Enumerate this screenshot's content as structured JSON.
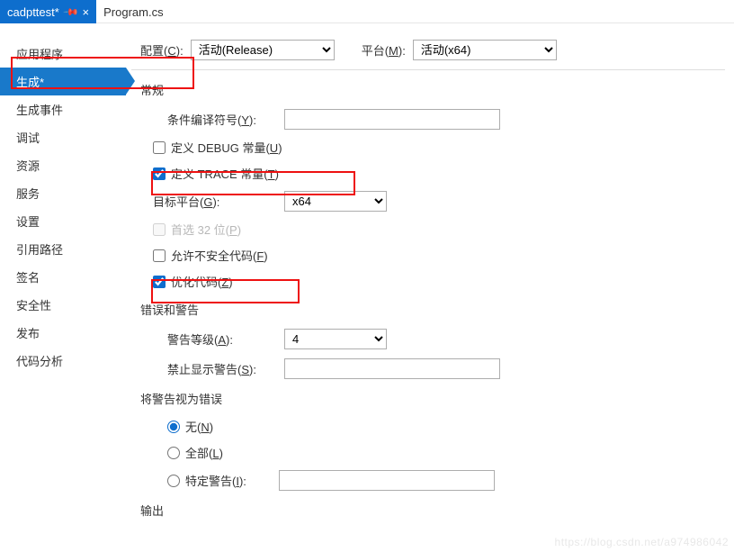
{
  "tabs": {
    "active": {
      "label": "cadpttest*",
      "pin": "⨯",
      "close": "×"
    },
    "inactive": {
      "label": "Program.cs"
    }
  },
  "sidebar": {
    "items": [
      "应用程序",
      "生成*",
      "生成事件",
      "调试",
      "资源",
      "服务",
      "设置",
      "引用路径",
      "签名",
      "安全性",
      "发布",
      "代码分析"
    ],
    "activeIndex": 1
  },
  "top": {
    "config_label_pre": "配置(",
    "config_key": "C",
    "config_label_post": "):",
    "config_value": "活动(Release)",
    "platform_label_pre": "平台(",
    "platform_key": "M",
    "platform_label_post": "):",
    "platform_value": "活动(x64)"
  },
  "general": {
    "title": "常规",
    "symbols_pre": "条件编译符号(",
    "symbols_key": "Y",
    "symbols_post": "):",
    "symbols_value": "",
    "debug_pre": "定义 DEBUG 常量(",
    "debug_key": "U",
    "debug_post": ")",
    "debug_checked": false,
    "trace_pre": "定义 TRACE 常量(",
    "trace_key": "T",
    "trace_post": ")",
    "trace_checked": true,
    "target_pre": "目标平台(",
    "target_key": "G",
    "target_post": "):",
    "target_value": "x64",
    "prefer32_pre": "首选 32 位(",
    "prefer32_key": "P",
    "prefer32_post": ")",
    "unsafe_pre": "允许不安全代码(",
    "unsafe_key": "F",
    "unsafe_post": ")",
    "unsafe_checked": false,
    "optimize_pre": "优化代码(",
    "optimize_key": "Z",
    "optimize_post": ")",
    "optimize_checked": true
  },
  "warnings": {
    "title": "错误和警告",
    "level_pre": "警告等级(",
    "level_key": "A",
    "level_post": "):",
    "level_value": "4",
    "suppress_pre": "禁止显示警告(",
    "suppress_key": "S",
    "suppress_post": "):",
    "suppress_value": ""
  },
  "treat": {
    "title": "将警告视为错误",
    "none_pre": "无(",
    "none_key": "N",
    "none_post": ")",
    "all_pre": "全部(",
    "all_key": "L",
    "all_post": ")",
    "specific_pre": "特定警告(",
    "specific_key": "I",
    "specific_post": "):",
    "specific_value": "",
    "selected": "none"
  },
  "output": {
    "title": "输出"
  },
  "watermark": "https://blog.csdn.net/a974986042"
}
